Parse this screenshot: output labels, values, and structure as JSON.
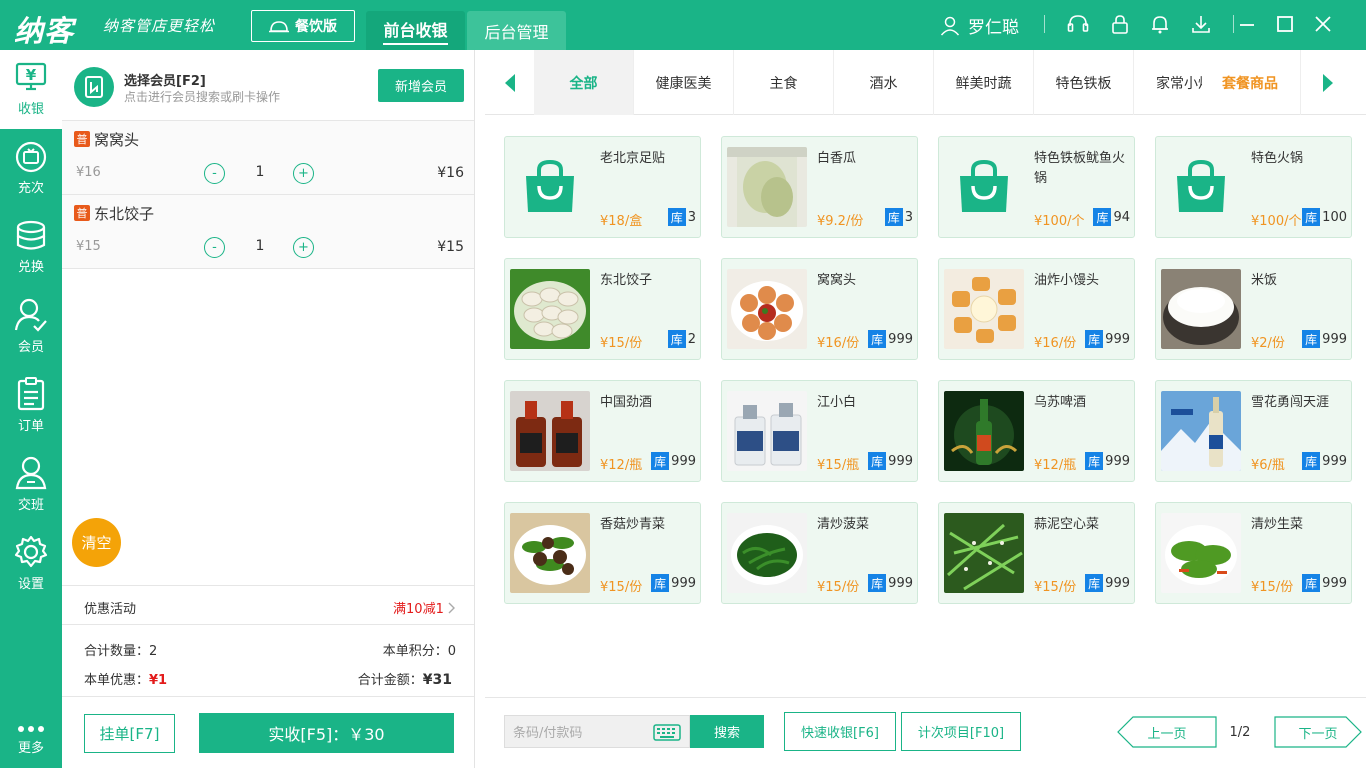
{
  "header": {
    "logo": "纳客",
    "slogan": "纳客管店更轻松",
    "edition": "餐饮版",
    "tabs": [
      {
        "label": "前台收银"
      },
      {
        "label": "后台管理"
      }
    ],
    "user": "罗仁聪"
  },
  "sidebar": {
    "items": [
      {
        "label": "收银",
        "icon": "cashier-icon"
      },
      {
        "label": "充次",
        "icon": "recharge-icon"
      },
      {
        "label": "兑换",
        "icon": "exchange-icon"
      },
      {
        "label": "会员",
        "icon": "member-icon"
      },
      {
        "label": "订单",
        "icon": "order-icon"
      },
      {
        "label": "交班",
        "icon": "shift-icon"
      },
      {
        "label": "设置",
        "icon": "settings-icon"
      }
    ],
    "more": "更多"
  },
  "member": {
    "title": "选择会员[F2]",
    "subtitle": "点击进行会员搜索或刷卡操作",
    "add_label": "新增会员"
  },
  "cart": {
    "items": [
      {
        "badge": "普",
        "name": "窝窝头",
        "unit_price": "¥16",
        "qty": "1",
        "total": "¥16"
      },
      {
        "badge": "普",
        "name": "东北饺子",
        "unit_price": "¥15",
        "qty": "1",
        "total": "¥15"
      }
    ],
    "clear_label": "清空",
    "minus": "-",
    "plus": "+"
  },
  "promo": {
    "label": "优惠活动",
    "value": "满10减1"
  },
  "summary": {
    "count_label": "合计数量：",
    "count": "2",
    "points_label": "本单积分：",
    "points": "0",
    "discount_label": "本单优惠：",
    "discount": "¥1",
    "total_label": "合计金额：",
    "total": "¥31"
  },
  "actions": {
    "hang": "挂单[F7]",
    "pay": "实收[F5]：￥30"
  },
  "categories": [
    {
      "label": "全部"
    },
    {
      "label": "健康医美"
    },
    {
      "label": "主食"
    },
    {
      "label": "酒水"
    },
    {
      "label": "鲜美时蔬"
    },
    {
      "label": "特色铁板"
    },
    {
      "label": "家常小炒"
    },
    {
      "label": "套餐商品"
    }
  ],
  "stock_label": "库",
  "products": [
    {
      "name": "老北京足贴",
      "price": "¥18/盒",
      "stock": "3",
      "img": "bag"
    },
    {
      "name": "白香瓜",
      "price": "¥9.2/份",
      "stock": "3",
      "img": "melon"
    },
    {
      "name": "特色铁板鱿鱼火锅",
      "price": "¥100/个",
      "stock": "94",
      "img": "bag"
    },
    {
      "name": "特色火锅",
      "price": "¥100/个",
      "stock": "100",
      "img": "bag"
    },
    {
      "name": "东北饺子",
      "price": "¥15/份",
      "stock": "2",
      "img": "dumpling"
    },
    {
      "name": "窝窝头",
      "price": "¥16/份",
      "stock": "999",
      "img": "bun"
    },
    {
      "name": "油炸小馒头",
      "price": "¥16/份",
      "stock": "999",
      "img": "fried"
    },
    {
      "name": "米饭",
      "price": "¥2/份",
      "stock": "999",
      "img": "rice"
    },
    {
      "name": "中国劲酒",
      "price": "¥12/瓶",
      "stock": "999",
      "img": "liquor"
    },
    {
      "name": "江小白",
      "price": "¥15/瓶",
      "stock": "999",
      "img": "jxb"
    },
    {
      "name": "乌苏啤酒",
      "price": "¥12/瓶",
      "stock": "999",
      "img": "beer"
    },
    {
      "name": "雪花勇闯天涯",
      "price": "¥6/瓶",
      "stock": "999",
      "img": "snow"
    },
    {
      "name": "香菇炒青菜",
      "price": "¥15/份",
      "stock": "999",
      "img": "veg1"
    },
    {
      "name": "清炒菠菜",
      "price": "¥15/份",
      "stock": "999",
      "img": "veg2"
    },
    {
      "name": "蒜泥空心菜",
      "price": "¥15/份",
      "stock": "999",
      "img": "veg3"
    },
    {
      "name": "清炒生菜",
      "price": "¥15/份",
      "stock": "999",
      "img": "veg4"
    }
  ],
  "bottom": {
    "barcode_placeholder": "条码/付款码",
    "search": "搜索",
    "quick": "快速收银[F6]",
    "count_item": "计次项目[F10]",
    "prev": "上一页",
    "page": "1/2",
    "next": "下一页"
  },
  "colors": {
    "primary": "#1ab487",
    "price": "#f09422",
    "stock_badge": "#1583e6",
    "badge": "#e85a1b",
    "clear": "#f4a308"
  }
}
